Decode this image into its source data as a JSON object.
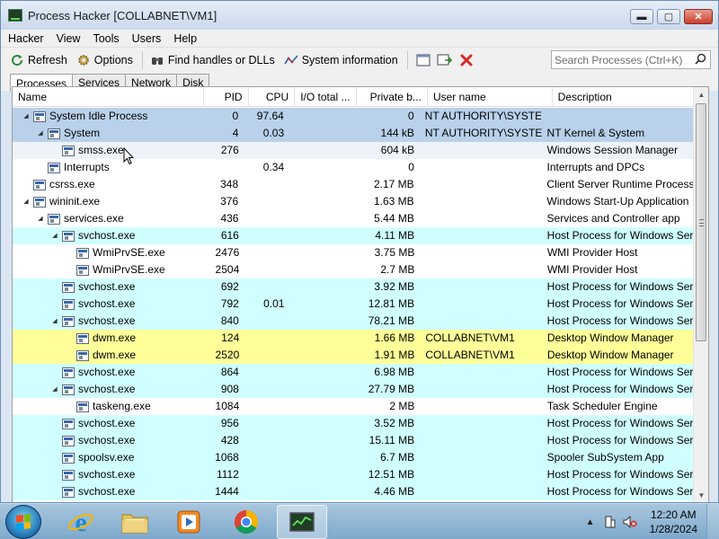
{
  "window": {
    "title": "Process Hacker [COLLABNET\\VM1]",
    "minimize_glyph": "▬",
    "maximize_glyph": "▢",
    "close_glyph": "✕"
  },
  "menu": [
    "Hacker",
    "View",
    "Tools",
    "Users",
    "Help"
  ],
  "toolbar": {
    "refresh_label": "Refresh",
    "options_label": "Options",
    "find_label": "Find handles or DLLs",
    "sysinfo_label": "System information",
    "search_placeholder": "Search Processes (Ctrl+K)"
  },
  "tabs": [
    "Processes",
    "Services",
    "Network",
    "Disk"
  ],
  "columns": {
    "name": "Name",
    "pid": "PID",
    "cpu": "CPU",
    "io": "I/O total ...",
    "private": "Private b...",
    "user": "User name",
    "desc": "Description"
  },
  "processes": [
    {
      "name": "System Idle Process",
      "pid": "0",
      "cpu": "97.64",
      "io": "",
      "private": "0",
      "user": "NT AUTHORITY\\SYSTEM",
      "desc": "",
      "indent": 0,
      "tree": "▲",
      "bg": "#b9d1ea"
    },
    {
      "name": "System",
      "pid": "4",
      "cpu": "0.03",
      "io": "",
      "private": "144 kB",
      "user": "NT AUTHORITY\\SYSTEM",
      "desc": "NT Kernel & System",
      "indent": 1,
      "tree": "▲",
      "bg": "#b9d1ea"
    },
    {
      "name": "smss.exe",
      "pid": "276",
      "cpu": "",
      "io": "",
      "private": "604 kB",
      "user": "",
      "desc": "Windows Session Manager",
      "indent": 2,
      "tree": "",
      "bg": "#eef3fa"
    },
    {
      "name": "Interrupts",
      "pid": "",
      "cpu": "0.34",
      "io": "",
      "private": "0",
      "user": "",
      "desc": "Interrupts and DPCs",
      "indent": 1,
      "tree": "",
      "bg": "#ffffff"
    },
    {
      "name": "csrss.exe",
      "pid": "348",
      "cpu": "",
      "io": "",
      "private": "2.17 MB",
      "user": "",
      "desc": "Client Server Runtime Process",
      "indent": 0,
      "tree": "",
      "bg": "#ffffff"
    },
    {
      "name": "wininit.exe",
      "pid": "376",
      "cpu": "",
      "io": "",
      "private": "1.63 MB",
      "user": "",
      "desc": "Windows Start-Up Application",
      "indent": 0,
      "tree": "▲",
      "bg": "#ffffff"
    },
    {
      "name": "services.exe",
      "pid": "436",
      "cpu": "",
      "io": "",
      "private": "5.44 MB",
      "user": "",
      "desc": "Services and Controller app",
      "indent": 1,
      "tree": "▲",
      "bg": "#ffffff"
    },
    {
      "name": "svchost.exe",
      "pid": "616",
      "cpu": "",
      "io": "",
      "private": "4.11 MB",
      "user": "",
      "desc": "Host Process for Windows Ser...",
      "indent": 2,
      "tree": "▲",
      "bg": "#d0ffff"
    },
    {
      "name": "WmiPrvSE.exe",
      "pid": "2476",
      "cpu": "",
      "io": "",
      "private": "3.75 MB",
      "user": "",
      "desc": "WMI Provider Host",
      "indent": 3,
      "tree": "",
      "bg": "#ffffff"
    },
    {
      "name": "WmiPrvSE.exe",
      "pid": "2504",
      "cpu": "",
      "io": "",
      "private": "2.7 MB",
      "user": "",
      "desc": "WMI Provider Host",
      "indent": 3,
      "tree": "",
      "bg": "#ffffff"
    },
    {
      "name": "svchost.exe",
      "pid": "692",
      "cpu": "",
      "io": "",
      "private": "3.92 MB",
      "user": "",
      "desc": "Host Process for Windows Ser...",
      "indent": 2,
      "tree": "",
      "bg": "#d0ffff"
    },
    {
      "name": "svchost.exe",
      "pid": "792",
      "cpu": "0.01",
      "io": "",
      "private": "12.81 MB",
      "user": "",
      "desc": "Host Process for Windows Ser...",
      "indent": 2,
      "tree": "",
      "bg": "#d0ffff"
    },
    {
      "name": "svchost.exe",
      "pid": "840",
      "cpu": "",
      "io": "",
      "private": "78.21 MB",
      "user": "",
      "desc": "Host Process for Windows Ser...",
      "indent": 2,
      "tree": "▲",
      "bg": "#d0ffff"
    },
    {
      "name": "dwm.exe",
      "pid": "124",
      "cpu": "",
      "io": "",
      "private": "1.66 MB",
      "user": "COLLABNET\\VM1",
      "desc": "Desktop Window Manager",
      "indent": 3,
      "tree": "",
      "bg": "#ffff99"
    },
    {
      "name": "dwm.exe",
      "pid": "2520",
      "cpu": "",
      "io": "",
      "private": "1.91 MB",
      "user": "COLLABNET\\VM1",
      "desc": "Desktop Window Manager",
      "indent": 3,
      "tree": "",
      "bg": "#ffff99"
    },
    {
      "name": "svchost.exe",
      "pid": "864",
      "cpu": "",
      "io": "",
      "private": "6.98 MB",
      "user": "",
      "desc": "Host Process for Windows Ser...",
      "indent": 2,
      "tree": "",
      "bg": "#d0ffff"
    },
    {
      "name": "svchost.exe",
      "pid": "908",
      "cpu": "",
      "io": "",
      "private": "27.79 MB",
      "user": "",
      "desc": "Host Process for Windows Ser...",
      "indent": 2,
      "tree": "▲",
      "bg": "#d0ffff"
    },
    {
      "name": "taskeng.exe",
      "pid": "1084",
      "cpu": "",
      "io": "",
      "private": "2 MB",
      "user": "",
      "desc": "Task Scheduler Engine",
      "indent": 3,
      "tree": "",
      "bg": "#ffffff"
    },
    {
      "name": "svchost.exe",
      "pid": "956",
      "cpu": "",
      "io": "",
      "private": "3.52 MB",
      "user": "",
      "desc": "Host Process for Windows Ser...",
      "indent": 2,
      "tree": "",
      "bg": "#d0ffff"
    },
    {
      "name": "svchost.exe",
      "pid": "428",
      "cpu": "",
      "io": "",
      "private": "15.11 MB",
      "user": "",
      "desc": "Host Process for Windows Ser...",
      "indent": 2,
      "tree": "",
      "bg": "#d0ffff"
    },
    {
      "name": "spoolsv.exe",
      "pid": "1068",
      "cpu": "",
      "io": "",
      "private": "6.7 MB",
      "user": "",
      "desc": "Spooler SubSystem App",
      "indent": 2,
      "tree": "",
      "bg": "#d0ffff"
    },
    {
      "name": "svchost.exe",
      "pid": "1112",
      "cpu": "",
      "io": "",
      "private": "12.51 MB",
      "user": "",
      "desc": "Host Process for Windows Ser...",
      "indent": 2,
      "tree": "",
      "bg": "#d0ffff"
    },
    {
      "name": "svchost.exe",
      "pid": "1444",
      "cpu": "",
      "io": "",
      "private": "4.46 MB",
      "user": "",
      "desc": "Host Process for Windows Ser...",
      "indent": 2,
      "tree": "",
      "bg": "#d0ffff"
    }
  ],
  "taskbar": {
    "time": "12:20 AM",
    "date": "1/28/2024",
    "apps": [
      "internet-explorer",
      "file-explorer",
      "media-player",
      "chrome",
      "process-hacker"
    ]
  },
  "colors": {
    "selected": "#b9d1ea",
    "service": "#d0ffff",
    "own_process": "#ffff99"
  }
}
